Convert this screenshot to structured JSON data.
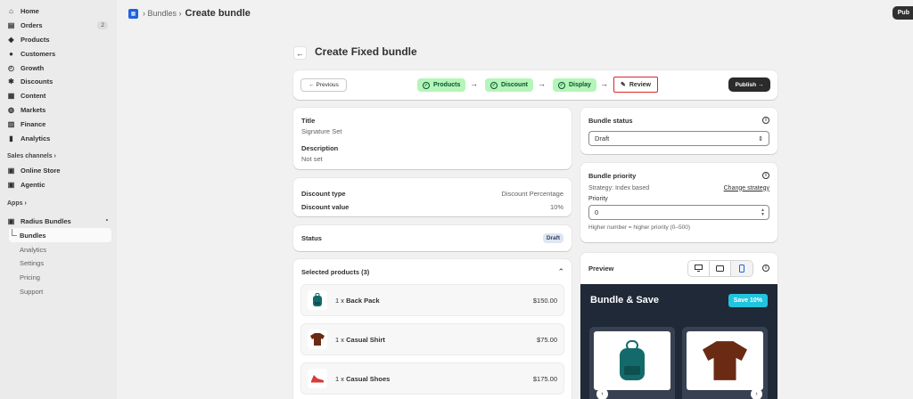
{
  "sidebar": {
    "items": [
      {
        "label": "Home",
        "icon": "home-icon",
        "glyph": "⌂"
      },
      {
        "label": "Orders",
        "icon": "orders-icon",
        "glyph": "▤",
        "badge": "2"
      },
      {
        "label": "Products",
        "icon": "tag-icon",
        "glyph": "◆"
      },
      {
        "label": "Customers",
        "icon": "person-icon",
        "glyph": "●"
      },
      {
        "label": "Growth",
        "icon": "growth-icon",
        "glyph": "◴"
      },
      {
        "label": "Discounts",
        "icon": "discount-icon",
        "glyph": "✱"
      },
      {
        "label": "Content",
        "icon": "content-icon",
        "glyph": "▦"
      },
      {
        "label": "Markets",
        "icon": "globe-icon",
        "glyph": "◍"
      },
      {
        "label": "Finance",
        "icon": "bank-icon",
        "glyph": "▥"
      },
      {
        "label": "Analytics",
        "icon": "bar-chart-icon",
        "glyph": "▮"
      }
    ],
    "sales_channels_label": "Sales channels",
    "channels": [
      {
        "label": "Online Store",
        "icon": "store-icon",
        "glyph": "▣"
      },
      {
        "label": "Agentic",
        "icon": "agentic-icon",
        "glyph": "▣"
      }
    ],
    "apps_label": "Apps",
    "app_name": "Radius Bundles",
    "app_subitems": [
      "Bundles",
      "Analytics",
      "Settings",
      "Pricing",
      "Support"
    ]
  },
  "topbar": {
    "crumb": "Bundles",
    "current": "Create bundle",
    "publish": "Pub"
  },
  "page": {
    "title": "Create Fixed bundle"
  },
  "stepper": {
    "previous": "← Previous",
    "steps": [
      "Products",
      "Discount",
      "Display"
    ],
    "review": "Review",
    "publish": "Publish →"
  },
  "bundle_info": {
    "title_label": "Title",
    "title_value": "Signature Set",
    "desc_label": "Description",
    "desc_value": "Not set"
  },
  "discount": {
    "type_label": "Discount type",
    "type_value": "Discount Percentage",
    "value_label": "Discount value",
    "value_value": "10%"
  },
  "status": {
    "label": "Status",
    "badge": "Draft"
  },
  "selected_products": {
    "header": "Selected products (3)",
    "items": [
      {
        "qty": "1 x",
        "name": "Back Pack",
        "price": "$150.00"
      },
      {
        "qty": "1 x",
        "name": "Casual Shirt",
        "price": "$75.00"
      },
      {
        "qty": "1 x",
        "name": "Casual Shoes",
        "price": "$175.00"
      }
    ]
  },
  "bundle_status": {
    "label": "Bundle status",
    "selected": "Draft"
  },
  "bundle_priority": {
    "label": "Bundle priority",
    "strategy": "Strategy: Index based",
    "change_link": "Change strategy",
    "priority_label": "Priority",
    "priority_value": "0",
    "help": "Higher number = higher priority (0–500)"
  },
  "preview": {
    "label": "Preview",
    "heading": "Bundle & Save",
    "badge": "Save 10%"
  },
  "colors": {
    "step_done_bg": "#b4f5b8",
    "review_outline": "#e02424",
    "preview_bg": "#1f2937",
    "save_badge": "#22c3dd"
  }
}
